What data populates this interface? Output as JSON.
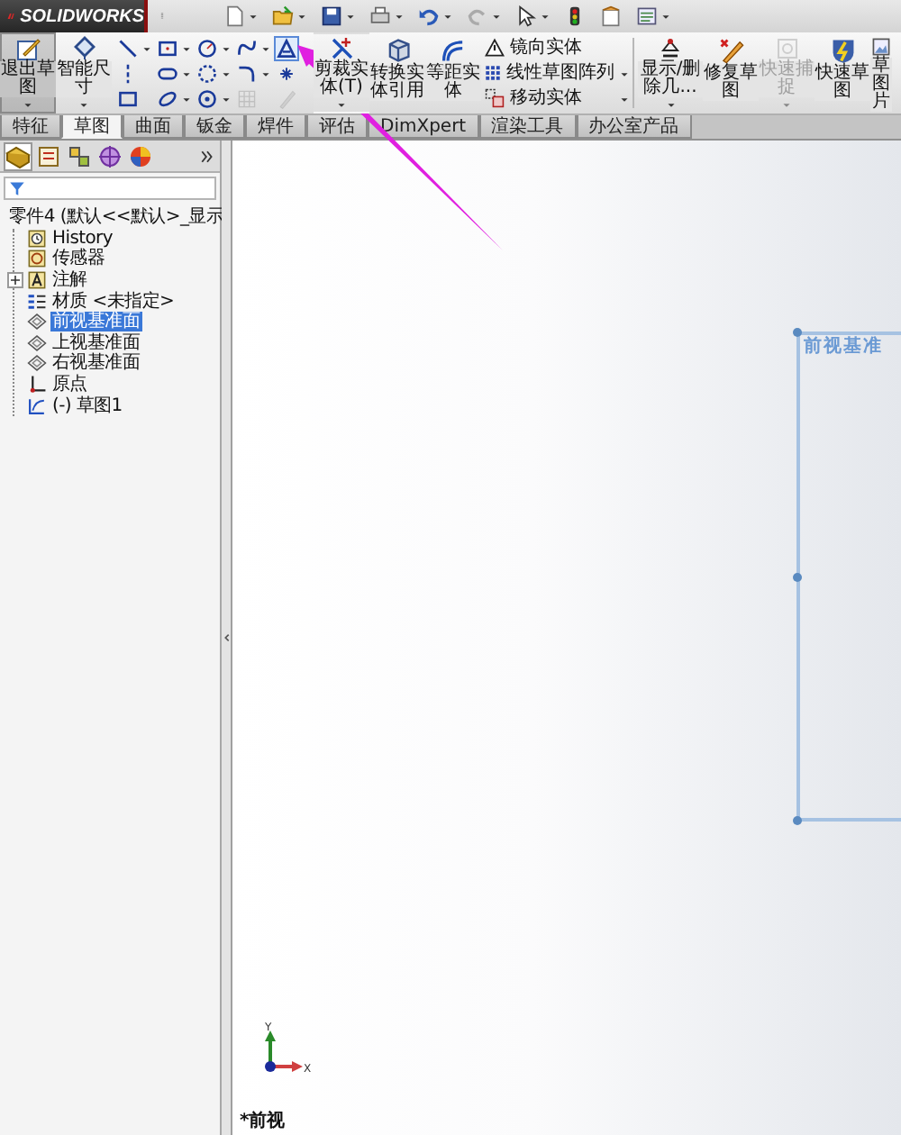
{
  "title_bar": {
    "logo_text": "SOLIDWORKS"
  },
  "ribbon": {
    "left_buttons": [
      {
        "kind": "exit-sketch",
        "label": "退出草图",
        "selected": true,
        "disabled": false,
        "dropdown": true
      },
      {
        "kind": "smart-dimension",
        "label": "智能尺寸",
        "selected": false,
        "disabled": false,
        "dropdown": true
      }
    ],
    "sketch_tools": [
      {
        "kind": "line",
        "dropdown": true,
        "selected": false,
        "disabled": false
      },
      {
        "kind": "rectangle",
        "dropdown": true,
        "selected": false,
        "disabled": false
      },
      {
        "kind": "circle",
        "dropdown": true,
        "selected": false,
        "disabled": false
      },
      {
        "kind": "spline",
        "dropdown": true,
        "selected": false,
        "disabled": false
      },
      {
        "kind": "text",
        "dropdown": false,
        "selected": true,
        "disabled": false
      },
      {
        "kind": "centerline",
        "dropdown": false,
        "selected": false,
        "disabled": false
      },
      {
        "kind": "slot",
        "dropdown": true,
        "selected": false,
        "disabled": false
      },
      {
        "kind": "polygon",
        "dropdown": true,
        "selected": false,
        "disabled": false
      },
      {
        "kind": "fillet",
        "dropdown": true,
        "selected": false,
        "disabled": false
      },
      {
        "kind": "point",
        "dropdown": false,
        "selected": false,
        "disabled": false
      },
      {
        "kind": "box",
        "dropdown": false,
        "selected": false,
        "disabled": false
      },
      {
        "kind": "ellipse",
        "dropdown": true,
        "selected": false,
        "disabled": false
      },
      {
        "kind": "ring",
        "dropdown": true,
        "selected": false,
        "disabled": false
      },
      {
        "kind": "grid",
        "dropdown": false,
        "selected": false,
        "disabled": true
      },
      {
        "kind": "pencil",
        "dropdown": false,
        "selected": false,
        "disabled": true
      }
    ],
    "middle_buttons": [
      {
        "kind": "trim",
        "label": "剪裁实体(T)",
        "selected": false,
        "disabled": false,
        "dropdown": true
      },
      {
        "kind": "convert",
        "label": "转换实体引用",
        "selected": false,
        "disabled": false,
        "dropdown": false
      },
      {
        "kind": "offset",
        "label": "等距实体",
        "selected": false,
        "disabled": false,
        "dropdown": false
      }
    ],
    "list_buttons": [
      {
        "kind": "mirror",
        "label": "镜向实体",
        "dropdown": false
      },
      {
        "kind": "pattern",
        "label": "线性草图阵列",
        "dropdown": true
      },
      {
        "kind": "move",
        "label": "移动实体",
        "dropdown": true
      }
    ],
    "right_buttons": [
      {
        "kind": "relations",
        "label": "显示/删除几...",
        "selected": false,
        "disabled": false,
        "dropdown": true
      },
      {
        "kind": "repair",
        "label": "修复草图",
        "selected": false,
        "disabled": false,
        "dropdown": false
      },
      {
        "kind": "snap",
        "label": "快速捕捉",
        "selected": false,
        "disabled": true,
        "dropdown": true
      },
      {
        "kind": "rapid",
        "label": "快速草图",
        "selected": false,
        "disabled": false,
        "dropdown": false
      },
      {
        "kind": "picture",
        "label": "草图片",
        "selected": false,
        "disabled": false,
        "dropdown": false
      }
    ]
  },
  "tabs": [
    {
      "label": "特征",
      "selected": false
    },
    {
      "label": "草图",
      "selected": true
    },
    {
      "label": "曲面",
      "selected": false
    },
    {
      "label": "钣金",
      "selected": false
    },
    {
      "label": "焊件",
      "selected": false
    },
    {
      "label": "评估",
      "selected": false
    },
    {
      "label": "DimXpert",
      "selected": false
    },
    {
      "label": "渲染工具",
      "selected": false
    },
    {
      "label": "办公室产品",
      "selected": false
    }
  ],
  "feature_tree": {
    "root": {
      "kind": "part",
      "label": "零件4 (默认<<默认>_显示",
      "selected": false
    },
    "items": [
      {
        "kind": "history",
        "label": "History",
        "selected": false
      },
      {
        "kind": "sensor",
        "label": "传感器",
        "selected": false
      },
      {
        "kind": "annotation",
        "label": "注解",
        "selected": false,
        "expanded": false
      },
      {
        "kind": "material",
        "label": "材质 <未指定>",
        "selected": false
      },
      {
        "kind": "plane",
        "label": "前视基准面",
        "selected": true
      },
      {
        "kind": "plane",
        "label": "上视基准面",
        "selected": false
      },
      {
        "kind": "plane",
        "label": "右视基准面",
        "selected": false
      },
      {
        "kind": "origin",
        "label": "原点",
        "selected": false
      },
      {
        "kind": "sketch",
        "label": "(-) 草图1",
        "selected": false
      }
    ]
  },
  "graphics": {
    "plane_label": "前视基准",
    "view_label": "*前视",
    "axis_y": "Y",
    "axis_x": "X"
  },
  "annotation": {
    "kind": "arrow"
  }
}
